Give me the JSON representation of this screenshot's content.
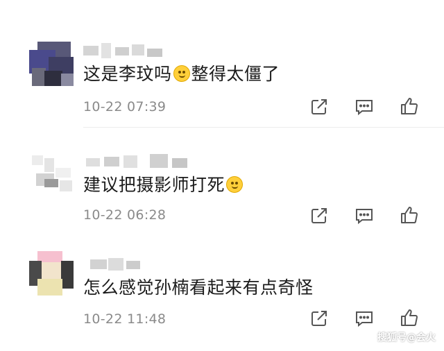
{
  "comments": [
    {
      "text_before": "这是李玟吗",
      "text_after": "整得太僵了",
      "emoji": "grimacing-emoji",
      "time": "10-22 07:39"
    },
    {
      "text_before": "建议把摄影师打死",
      "text_after": "",
      "emoji": "squinting-emoji",
      "time": "10-22 06:28"
    },
    {
      "text_before": "怎么感觉孙楠看起来有点奇怪",
      "text_after": "",
      "emoji": "",
      "time": "10-22 11:48"
    }
  ],
  "icons": {
    "share": "share-icon",
    "reply": "reply-icon",
    "like": "thumbs-up-icon"
  },
  "watermark": "搜狐号@会火",
  "colors": {
    "text": "#1b1b1b",
    "time": "#8a8a8a",
    "icon": "#555555",
    "divider": "#ececec"
  }
}
